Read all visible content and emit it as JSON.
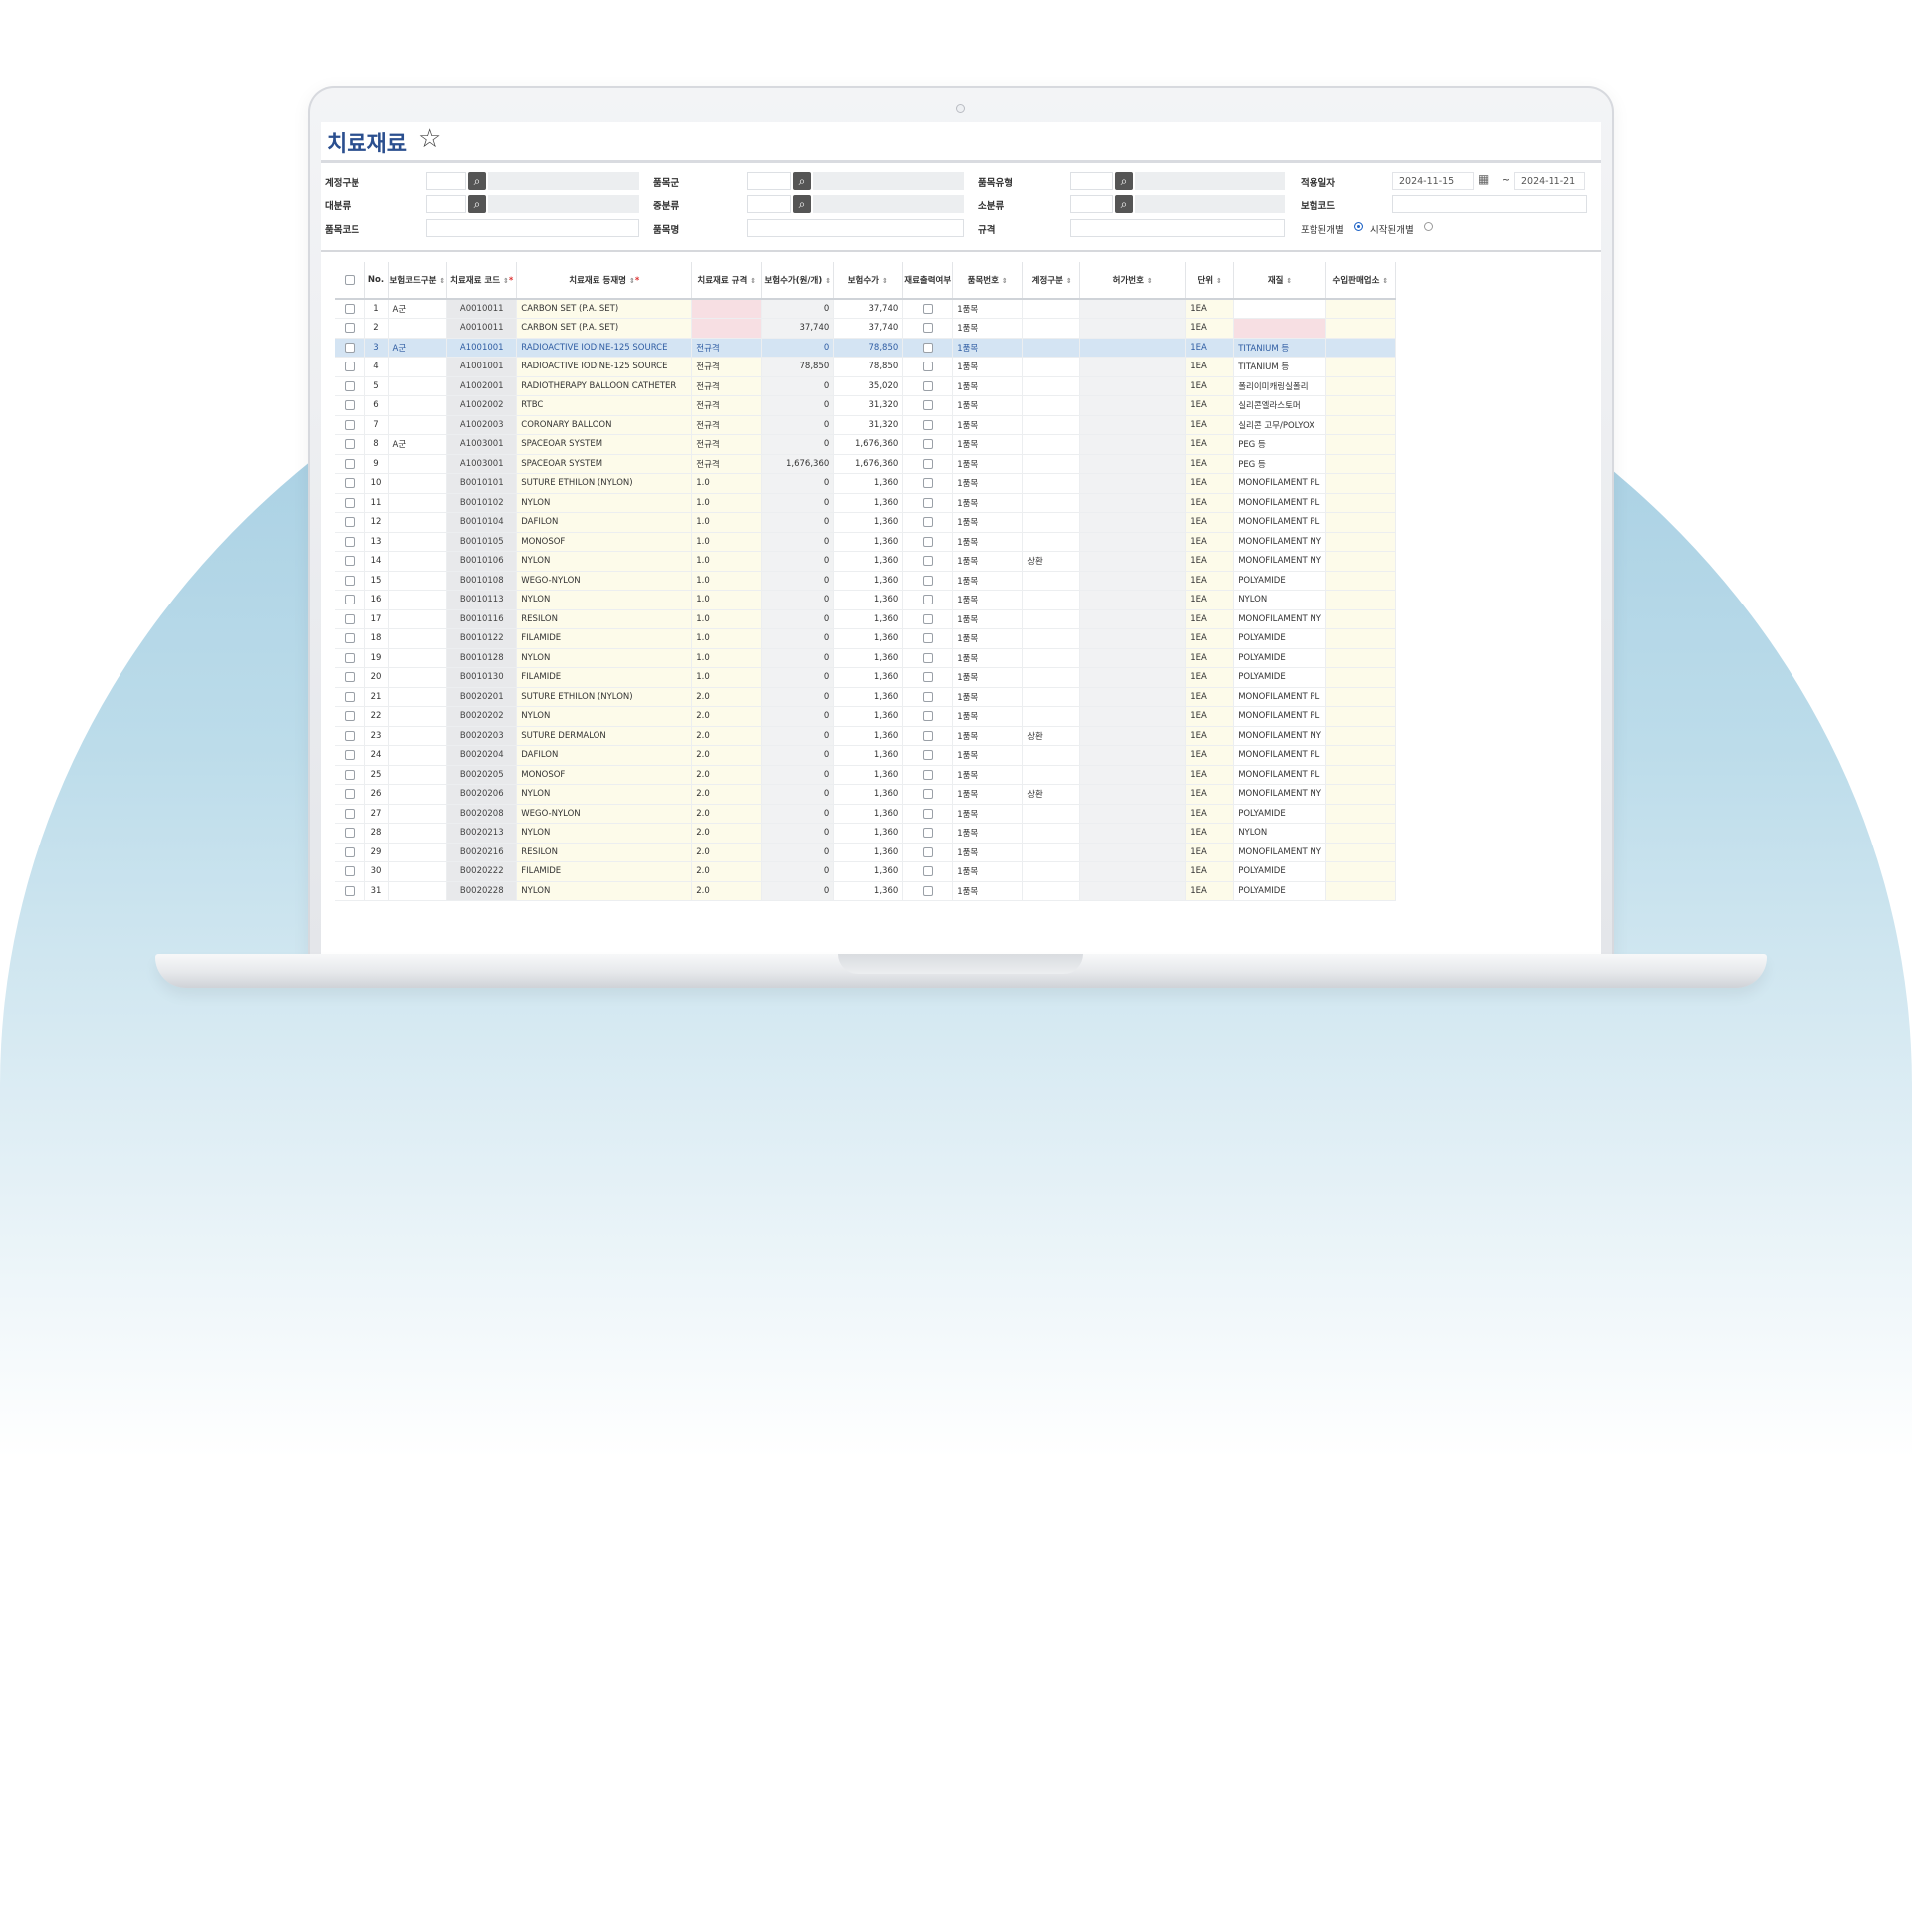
{
  "app": {
    "title": "치료재료"
  },
  "filters": {
    "labels": {
      "f1": "계정구분",
      "f2": "품목군",
      "f3": "품목유형",
      "f4": "적용일자",
      "f5": "대분류",
      "f6": "중분류",
      "f7": "소분류",
      "f8": "보험코드",
      "f9": "품목코드",
      "f10": "품목명",
      "f11": "규격"
    },
    "date_from": "2024-11-15",
    "date_to": "2024-11-21",
    "date_separator": "~",
    "radio1_label": "포함된개별",
    "radio2_label": "시작된개별"
  },
  "table": {
    "columns": [
      "No.",
      "보험코드구분",
      "치료재료 코드",
      "치료재료 등재명",
      "치료재료 규격",
      "보험수가(원/개)",
      "보험수가",
      "재료출력여부",
      "품목번호",
      "계정구분",
      "허가번호",
      "단위",
      "재질",
      "수입판매업소"
    ],
    "rows": [
      {
        "no": "1",
        "grp": "A군",
        "code": "A0010011",
        "name": "CARBON SET (P.A. SET)",
        "spec": "",
        "price1": "0",
        "price2": "37,740",
        "unit1": "1품목",
        "acc": "",
        "u": "1EA",
        "mat": ""
      },
      {
        "no": "2",
        "grp": "",
        "code": "A0010011",
        "name": "CARBON SET (P.A. SET)",
        "spec": "",
        "price1": "37,740",
        "price2": "37,740",
        "unit1": "1품목",
        "acc": "",
        "u": "1EA",
        "mat": ""
      },
      {
        "no": "3",
        "grp": "A군",
        "code": "A1001001",
        "name": "RADIOACTIVE IODINE-125 SOURCE",
        "spec": "전규격",
        "price1": "0",
        "price2": "78,850",
        "unit1": "1품목",
        "acc": "",
        "u": "1EA",
        "mat": "TITANIUM 등"
      },
      {
        "no": "4",
        "grp": "",
        "code": "A1001001",
        "name": "RADIOACTIVE IODINE-125 SOURCE",
        "spec": "전규격",
        "price1": "78,850",
        "price2": "78,850",
        "unit1": "1품목",
        "acc": "",
        "u": "1EA",
        "mat": "TITANIUM 등"
      },
      {
        "no": "5",
        "grp": "",
        "code": "A1002001",
        "name": "RADIOTHERAPY BALLOON CATHETER",
        "spec": "전규격",
        "price1": "0",
        "price2": "35,020",
        "unit1": "1품목",
        "acc": "",
        "u": "1EA",
        "mat": "폴리이미캐링실폴리"
      },
      {
        "no": "6",
        "grp": "",
        "code": "A1002002",
        "name": "RTBC",
        "spec": "전규격",
        "price1": "0",
        "price2": "31,320",
        "unit1": "1품목",
        "acc": "",
        "u": "1EA",
        "mat": "실리콘엘라스토머"
      },
      {
        "no": "7",
        "grp": "",
        "code": "A1002003",
        "name": "CORONARY BALLOON",
        "spec": "전규격",
        "price1": "0",
        "price2": "31,320",
        "unit1": "1품목",
        "acc": "",
        "u": "1EA",
        "mat": "실리콘 고무/POLYOX"
      },
      {
        "no": "8",
        "grp": "A군",
        "code": "A1003001",
        "name": "SPACEOAR SYSTEM",
        "spec": "전규격",
        "price1": "0",
        "price2": "1,676,360",
        "unit1": "1품목",
        "acc": "",
        "u": "1EA",
        "mat": "PEG 등"
      },
      {
        "no": "9",
        "grp": "",
        "code": "A1003001",
        "name": "SPACEOAR SYSTEM",
        "spec": "전규격",
        "price1": "1,676,360",
        "price2": "1,676,360",
        "unit1": "1품목",
        "acc": "",
        "u": "1EA",
        "mat": "PEG 등"
      },
      {
        "no": "10",
        "grp": "",
        "code": "B0010101",
        "name": "SUTURE ETHILON (NYLON)",
        "spec": "1.0",
        "price1": "0",
        "price2": "1,360",
        "unit1": "1품목",
        "acc": "",
        "u": "1EA",
        "mat": "MONOFILAMENT PL"
      },
      {
        "no": "11",
        "grp": "",
        "code": "B0010102",
        "name": "NYLON",
        "spec": "1.0",
        "price1": "0",
        "price2": "1,360",
        "unit1": "1품목",
        "acc": "",
        "u": "1EA",
        "mat": "MONOFILAMENT PL"
      },
      {
        "no": "12",
        "grp": "",
        "code": "B0010104",
        "name": "DAFILON",
        "spec": "1.0",
        "price1": "0",
        "price2": "1,360",
        "unit1": "1품목",
        "acc": "",
        "u": "1EA",
        "mat": "MONOFILAMENT PL"
      },
      {
        "no": "13",
        "grp": "",
        "code": "B0010105",
        "name": "MONOSOF",
        "spec": "1.0",
        "price1": "0",
        "price2": "1,360",
        "unit1": "1품목",
        "acc": "",
        "u": "1EA",
        "mat": "MONOFILAMENT NY"
      },
      {
        "no": "14",
        "grp": "",
        "code": "B0010106",
        "name": "NYLON",
        "spec": "1.0",
        "price1": "0",
        "price2": "1,360",
        "unit1": "1품목",
        "acc": "상환",
        "u": "1EA",
        "mat": "MONOFILAMENT NY"
      },
      {
        "no": "15",
        "grp": "",
        "code": "B0010108",
        "name": "WEGO-NYLON",
        "spec": "1.0",
        "price1": "0",
        "price2": "1,360",
        "unit1": "1품목",
        "acc": "",
        "u": "1EA",
        "mat": "POLYAMIDE"
      },
      {
        "no": "16",
        "grp": "",
        "code": "B0010113",
        "name": "NYLON",
        "spec": "1.0",
        "price1": "0",
        "price2": "1,360",
        "unit1": "1품목",
        "acc": "",
        "u": "1EA",
        "mat": "NYLON"
      },
      {
        "no": "17",
        "grp": "",
        "code": "B0010116",
        "name": "RESILON",
        "spec": "1.0",
        "price1": "0",
        "price2": "1,360",
        "unit1": "1품목",
        "acc": "",
        "u": "1EA",
        "mat": "MONOFILAMENT NY"
      },
      {
        "no": "18",
        "grp": "",
        "code": "B0010122",
        "name": "FILAMIDE",
        "spec": "1.0",
        "price1": "0",
        "price2": "1,360",
        "unit1": "1품목",
        "acc": "",
        "u": "1EA",
        "mat": "POLYAMIDE"
      },
      {
        "no": "19",
        "grp": "",
        "code": "B0010128",
        "name": "NYLON",
        "spec": "1.0",
        "price1": "0",
        "price2": "1,360",
        "unit1": "1품목",
        "acc": "",
        "u": "1EA",
        "mat": "POLYAMIDE"
      },
      {
        "no": "20",
        "grp": "",
        "code": "B0010130",
        "name": "FILAMIDE",
        "spec": "1.0",
        "price1": "0",
        "price2": "1,360",
        "unit1": "1품목",
        "acc": "",
        "u": "1EA",
        "mat": "POLYAMIDE"
      },
      {
        "no": "21",
        "grp": "",
        "code": "B0020201",
        "name": "SUTURE ETHILON (NYLON)",
        "spec": "2.0",
        "price1": "0",
        "price2": "1,360",
        "unit1": "1품목",
        "acc": "",
        "u": "1EA",
        "mat": "MONOFILAMENT PL"
      },
      {
        "no": "22",
        "grp": "",
        "code": "B0020202",
        "name": "NYLON",
        "spec": "2.0",
        "price1": "0",
        "price2": "1,360",
        "unit1": "1품목",
        "acc": "",
        "u": "1EA",
        "mat": "MONOFILAMENT PL"
      },
      {
        "no": "23",
        "grp": "",
        "code": "B0020203",
        "name": "SUTURE DERMALON",
        "spec": "2.0",
        "price1": "0",
        "price2": "1,360",
        "unit1": "1품목",
        "acc": "상환",
        "u": "1EA",
        "mat": "MONOFILAMENT NY"
      },
      {
        "no": "24",
        "grp": "",
        "code": "B0020204",
        "name": "DAFILON",
        "spec": "2.0",
        "price1": "0",
        "price2": "1,360",
        "unit1": "1품목",
        "acc": "",
        "u": "1EA",
        "mat": "MONOFILAMENT PL"
      },
      {
        "no": "25",
        "grp": "",
        "code": "B0020205",
        "name": "MONOSOF",
        "spec": "2.0",
        "price1": "0",
        "price2": "1,360",
        "unit1": "1품목",
        "acc": "",
        "u": "1EA",
        "mat": "MONOFILAMENT PL"
      },
      {
        "no": "26",
        "grp": "",
        "code": "B0020206",
        "name": "NYLON",
        "spec": "2.0",
        "price1": "0",
        "price2": "1,360",
        "unit1": "1품목",
        "acc": "상환",
        "u": "1EA",
        "mat": "MONOFILAMENT NY"
      },
      {
        "no": "27",
        "grp": "",
        "code": "B0020208",
        "name": "WEGO-NYLON",
        "spec": "2.0",
        "price1": "0",
        "price2": "1,360",
        "unit1": "1품목",
        "acc": "",
        "u": "1EA",
        "mat": "POLYAMIDE"
      },
      {
        "no": "28",
        "grp": "",
        "code": "B0020213",
        "name": "NYLON",
        "spec": "2.0",
        "price1": "0",
        "price2": "1,360",
        "unit1": "1품목",
        "acc": "",
        "u": "1EA",
        "mat": "NYLON"
      },
      {
        "no": "29",
        "grp": "",
        "code": "B0020216",
        "name": "RESILON",
        "spec": "2.0",
        "price1": "0",
        "price2": "1,360",
        "unit1": "1품목",
        "acc": "",
        "u": "1EA",
        "mat": "MONOFILAMENT NY"
      },
      {
        "no": "30",
        "grp": "",
        "code": "B0020222",
        "name": "FILAMIDE",
        "spec": "2.0",
        "price1": "0",
        "price2": "1,360",
        "unit1": "1품목",
        "acc": "",
        "u": "1EA",
        "mat": "POLYAMIDE"
      },
      {
        "no": "31",
        "grp": "",
        "code": "B0020228",
        "name": "NYLON",
        "spec": "2.0",
        "price1": "0",
        "price2": "1,360",
        "unit1": "1품목",
        "acc": "",
        "u": "1EA",
        "mat": "POLYAMIDE"
      }
    ]
  },
  "colors": {
    "accent": "#2b4f8f",
    "selected_row": "#d4e4f3",
    "code_cell": "#e8e9eb",
    "name_cell": "#fdfbea",
    "invalid_cell": "#f7dfe3",
    "bg_arc": "#9fcae0"
  }
}
